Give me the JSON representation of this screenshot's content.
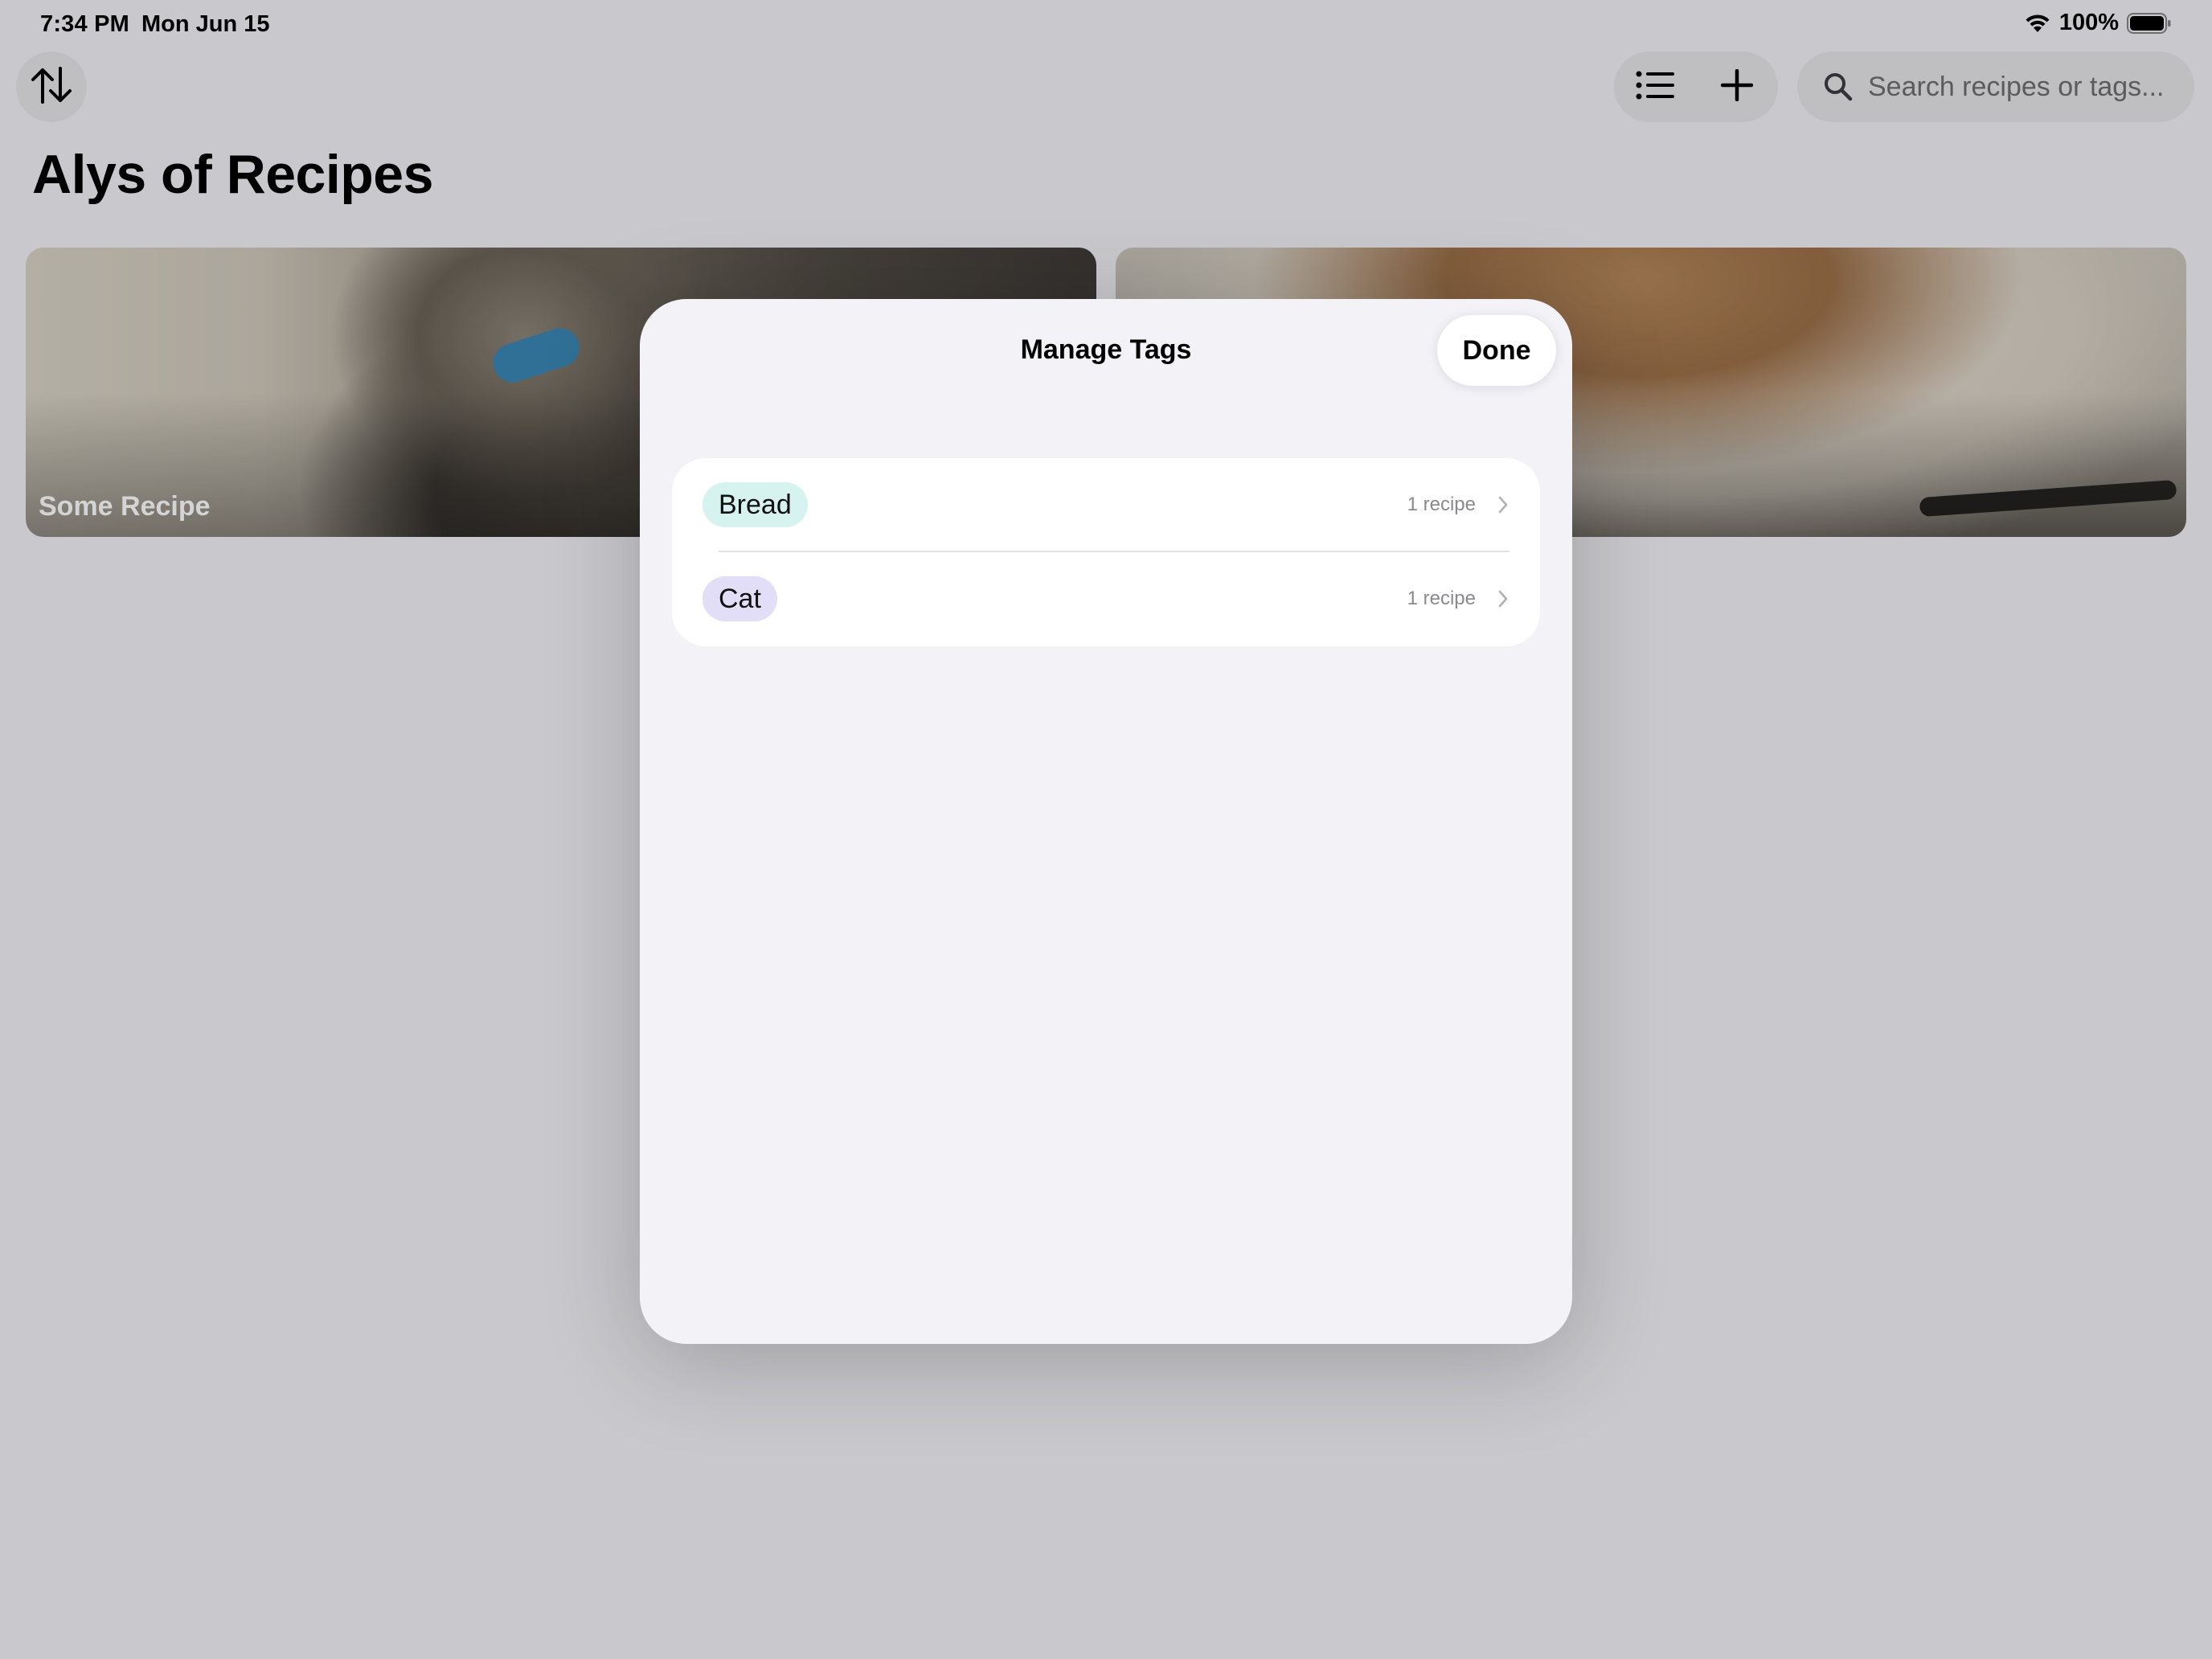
{
  "status_bar": {
    "time": "7:34 PM",
    "date": "Mon Jun 15",
    "battery": "100%"
  },
  "toolbar": {
    "sort_icon": "sort-arrows-icon",
    "list_icon": "list-icon",
    "add_icon": "plus-icon",
    "search_placeholder": "Search recipes or tags..."
  },
  "page": {
    "title": "Alys of Recipes"
  },
  "recipes": [
    {
      "title": "Some Recipe"
    },
    {
      "title": ""
    }
  ],
  "modal": {
    "title": "Manage Tags",
    "done_label": "Done",
    "tags": [
      {
        "name": "Bread",
        "count": "1 recipe",
        "color": "#d7f3ef"
      },
      {
        "name": "Cat",
        "count": "1 recipe",
        "color": "#e3def7"
      }
    ]
  },
  "colors": {
    "background": "#f2f2f7",
    "sheet": "#f2f2f7",
    "card": "#ffffff",
    "secondary_text": "#8a8a8e"
  }
}
